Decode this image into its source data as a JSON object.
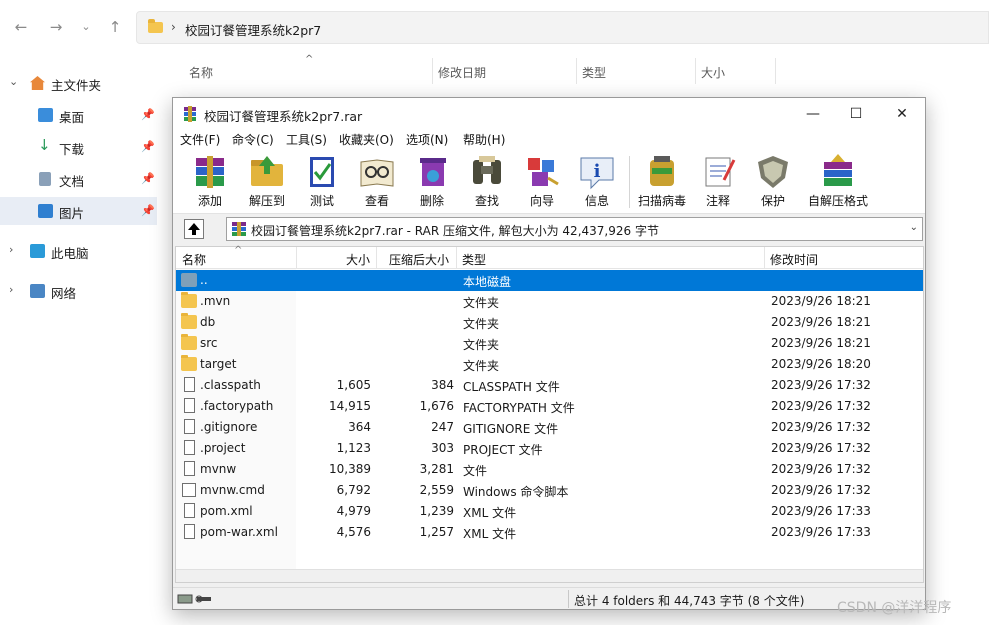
{
  "explorer": {
    "address_path": "校园订餐管理系统k2pr7",
    "sidebar": [
      {
        "label": "主文件夹",
        "icon": "home-icon"
      },
      {
        "label": "桌面",
        "icon": "desktop-icon"
      },
      {
        "label": "下载",
        "icon": "download-icon"
      },
      {
        "label": "文档",
        "icon": "document-icon"
      },
      {
        "label": "图片",
        "icon": "pictures-icon"
      },
      {
        "label": "此电脑",
        "icon": "computer-icon"
      },
      {
        "label": "网络",
        "icon": "network-icon"
      }
    ],
    "columns": [
      "名称",
      "修改日期",
      "类型",
      "大小"
    ]
  },
  "rar": {
    "title": "校园订餐管理系统k2pr7.rar",
    "menu": [
      "文件(F)",
      "命令(C)",
      "工具(S)",
      "收藏夹(O)",
      "选项(N)",
      "帮助(H)"
    ],
    "toolbar": [
      "添加",
      "解压到",
      "测试",
      "查看",
      "删除",
      "查找",
      "向导",
      "信息",
      "扫描病毒",
      "注释",
      "保护",
      "自解压格式"
    ],
    "path_text": "校园订餐管理系统k2pr7.rar - RAR 压缩文件, 解包大小为 42,437,926 字节",
    "columns": [
      "名称",
      "大小",
      "压缩后大小",
      "类型",
      "修改时间"
    ],
    "files": [
      {
        "name": "..",
        "size": "",
        "packed": "",
        "type": "本地磁盘",
        "modified": "",
        "kind": "drive"
      },
      {
        "name": ".mvn",
        "size": "",
        "packed": "",
        "type": "文件夹",
        "modified": "2023/9/26 18:21",
        "kind": "folder"
      },
      {
        "name": "db",
        "size": "",
        "packed": "",
        "type": "文件夹",
        "modified": "2023/9/26 18:21",
        "kind": "folder"
      },
      {
        "name": "src",
        "size": "",
        "packed": "",
        "type": "文件夹",
        "modified": "2023/9/26 18:21",
        "kind": "folder"
      },
      {
        "name": "target",
        "size": "",
        "packed": "",
        "type": "文件夹",
        "modified": "2023/9/26 18:20",
        "kind": "folder"
      },
      {
        "name": ".classpath",
        "size": "1,605",
        "packed": "384",
        "type": "CLASSPATH 文件",
        "modified": "2023/9/26 17:32",
        "kind": "file"
      },
      {
        "name": ".factorypath",
        "size": "14,915",
        "packed": "1,676",
        "type": "FACTORYPATH 文件",
        "modified": "2023/9/26 17:32",
        "kind": "file"
      },
      {
        "name": ".gitignore",
        "size": "364",
        "packed": "247",
        "type": "GITIGNORE 文件",
        "modified": "2023/9/26 17:32",
        "kind": "file"
      },
      {
        "name": ".project",
        "size": "1,123",
        "packed": "303",
        "type": "PROJECT 文件",
        "modified": "2023/9/26 17:32",
        "kind": "file"
      },
      {
        "name": "mvnw",
        "size": "10,389",
        "packed": "3,281",
        "type": "文件",
        "modified": "2023/9/26 17:32",
        "kind": "file"
      },
      {
        "name": "mvnw.cmd",
        "size": "6,792",
        "packed": "2,559",
        "type": "Windows 命令脚本",
        "modified": "2023/9/26 17:32",
        "kind": "cmd"
      },
      {
        "name": "pom.xml",
        "size": "4,979",
        "packed": "1,239",
        "type": "XML 文件",
        "modified": "2023/9/26 17:33",
        "kind": "file"
      },
      {
        "name": "pom-war.xml",
        "size": "4,576",
        "packed": "1,257",
        "type": "XML 文件",
        "modified": "2023/9/26 17:33",
        "kind": "file"
      }
    ],
    "status": "总计 4 folders 和 44,743 字节 (8 个文件)"
  },
  "watermark": "CSDN @洋洋程序"
}
